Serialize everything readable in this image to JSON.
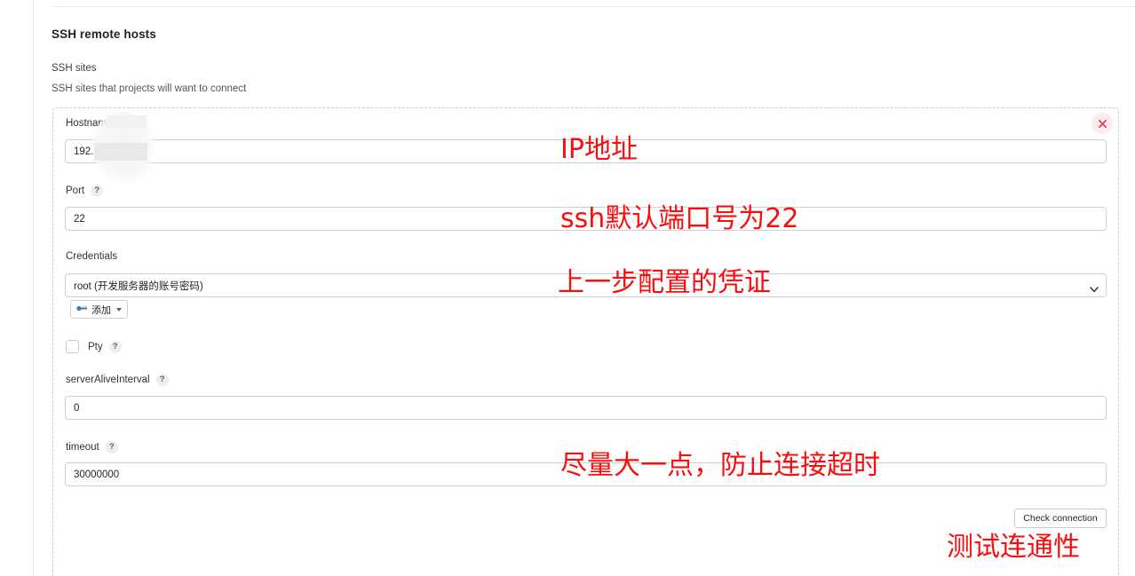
{
  "section": {
    "title": "SSH remote hosts",
    "sites_label": "SSH sites",
    "sites_desc": "SSH sites that projects will want to connect"
  },
  "host": {
    "remove_icon": "close-icon",
    "fields": {
      "hostname": {
        "label": "Hostname",
        "value": "192.1",
        "redacted": true
      },
      "port": {
        "label": "Port",
        "help": "?",
        "value": "22"
      },
      "credentials": {
        "label": "Credentials",
        "value": "root (开发服务器的账号密码)",
        "chevron_icon": "chevron-down-icon",
        "add_button": {
          "label": "添加",
          "icon": "key-icon",
          "caret": "caret-down-icon"
        }
      },
      "pty": {
        "label": "Pty",
        "help": "?",
        "checked": false
      },
      "server_alive_interval": {
        "label": "serverAliveInterval",
        "help": "?",
        "value": "0"
      },
      "timeout": {
        "label": "timeout",
        "help": "?",
        "value": "30000000"
      }
    },
    "check_connection_label": "Check connection"
  },
  "annotations": {
    "ip": "IP地址",
    "port": "ssh默认端口号为22",
    "credentials": "上一步配置的凭证",
    "timeout": "尽量大一点，防止连接超时",
    "test": "测试连通性"
  },
  "colors": {
    "annotation_red": "#fb0d0d",
    "remove_bg": "#fdecee",
    "remove_fg": "#e3344a",
    "border": "#ccd1d7",
    "card_dashed": "#c9ccd1"
  }
}
